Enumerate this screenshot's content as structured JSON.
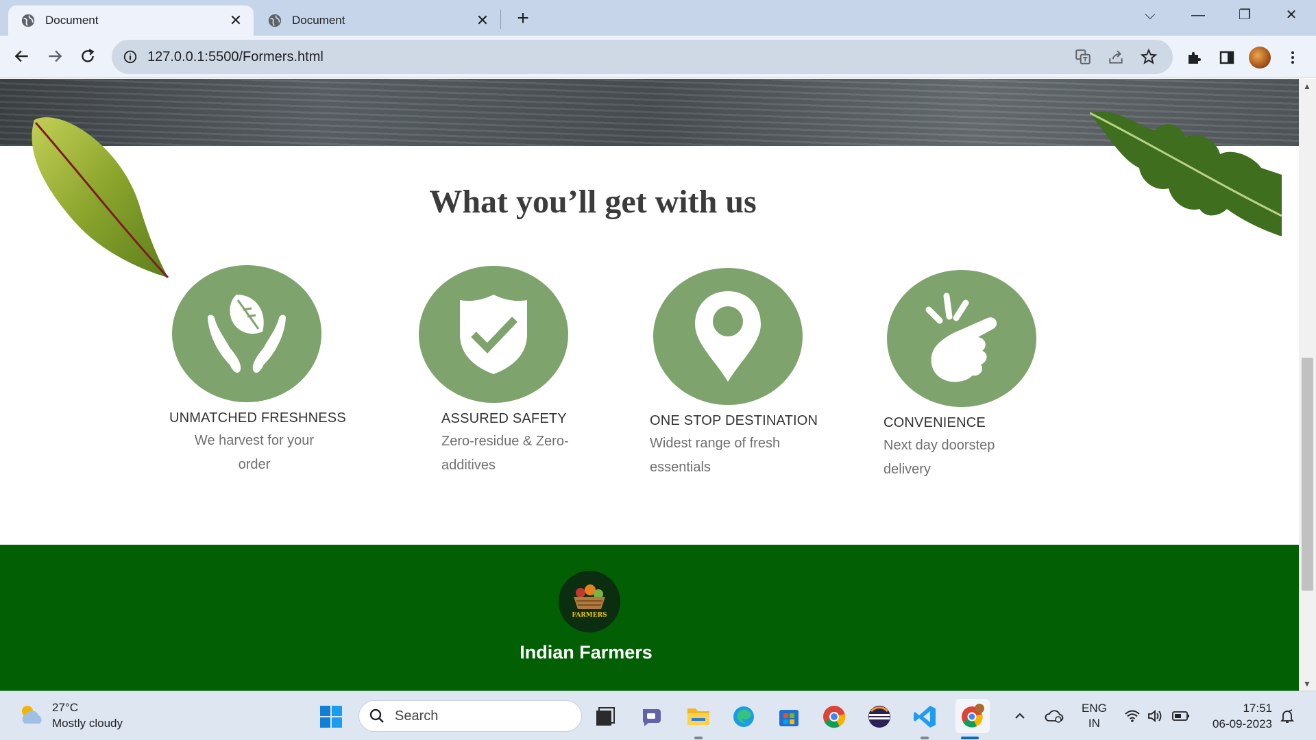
{
  "browser": {
    "tabs": [
      {
        "title": "Document",
        "active": true
      },
      {
        "title": "Document",
        "active": false
      }
    ],
    "new_tab_label": "+",
    "url": "127.0.0.1:5500/Formers.html"
  },
  "page": {
    "section_title": "What you’ll get with us",
    "features": [
      {
        "icon": "hands-leaf-icon",
        "title": "UNMATCHED FRESHNESS",
        "desc_line1": "We harvest for your",
        "desc_line2": "order"
      },
      {
        "icon": "shield-check-icon",
        "title": "ASSURED SAFETY",
        "desc_line1": "Zero-residue & Zero-",
        "desc_line2": "additives"
      },
      {
        "icon": "location-pin-icon",
        "title": "ONE STOP DESTINATION",
        "desc_line1": "Widest range of fresh",
        "desc_line2": "essentials"
      },
      {
        "icon": "tap-hand-icon",
        "title": "CONVENIENCE",
        "desc_line1": "Next day doorstep",
        "desc_line2": "delivery"
      }
    ],
    "footer": {
      "logo_text": "FARMERS",
      "brand": "Indian Farmers"
    },
    "colors": {
      "feature_circle": "#7fa36d",
      "footer_bg": "#025f04"
    }
  },
  "taskbar": {
    "weather_temp": "27°C",
    "weather_desc": "Mostly cloudy",
    "search_placeholder": "Search",
    "lang_line1": "ENG",
    "lang_line2": "IN",
    "time": "17:51",
    "date": "06-09-2023"
  }
}
